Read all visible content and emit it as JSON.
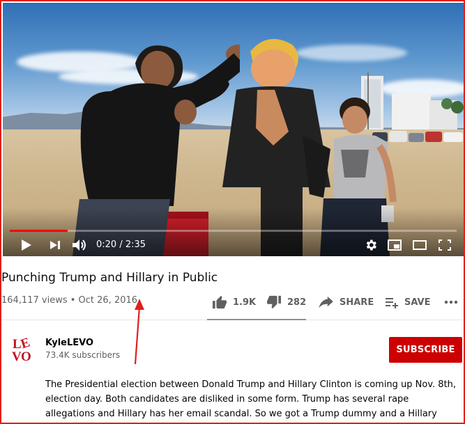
{
  "video": {
    "current_time": "0:20",
    "duration": "2:35",
    "time_display": "0:20 / 2:35",
    "progress": 0.129
  },
  "meta": {
    "title": "Punching Trump and Hillary in Public",
    "views_date": "164,117 views • Oct 26, 2016"
  },
  "actions": {
    "like_count": "1.9K",
    "dislike_count": "282",
    "share_label": "SHARE",
    "save_label": "SAVE"
  },
  "channel": {
    "name": "KyleLEVO",
    "subscribers": "73.4K subscribers",
    "avatar_text": "LEVO",
    "subscribe_label": "SUBSCRIBE"
  },
  "description": "The Presidential election between Donald Trump and Hillary Clinton is coming up Nov. 8th, election day. Both candidates are disliked in some form. Trump has several rape allegations and Hillary has her email scandal. So we got a Trump dummy and a Hillary dummy and let people",
  "colors": {
    "border": "#e0201b",
    "progress": "#ff0000",
    "subscribe": "#cc0000",
    "arrow": "#e0201b"
  },
  "icons": {
    "play": "play-icon",
    "next": "next-icon",
    "volume": "volume-icon",
    "settings": "gear-icon",
    "miniplayer": "miniplayer-icon",
    "theater": "theater-icon",
    "fullscreen": "fullscreen-icon",
    "like": "thumbs-up-icon",
    "dislike": "thumbs-down-icon",
    "share": "share-icon",
    "save": "playlist-add-icon",
    "more": "more-icon"
  }
}
